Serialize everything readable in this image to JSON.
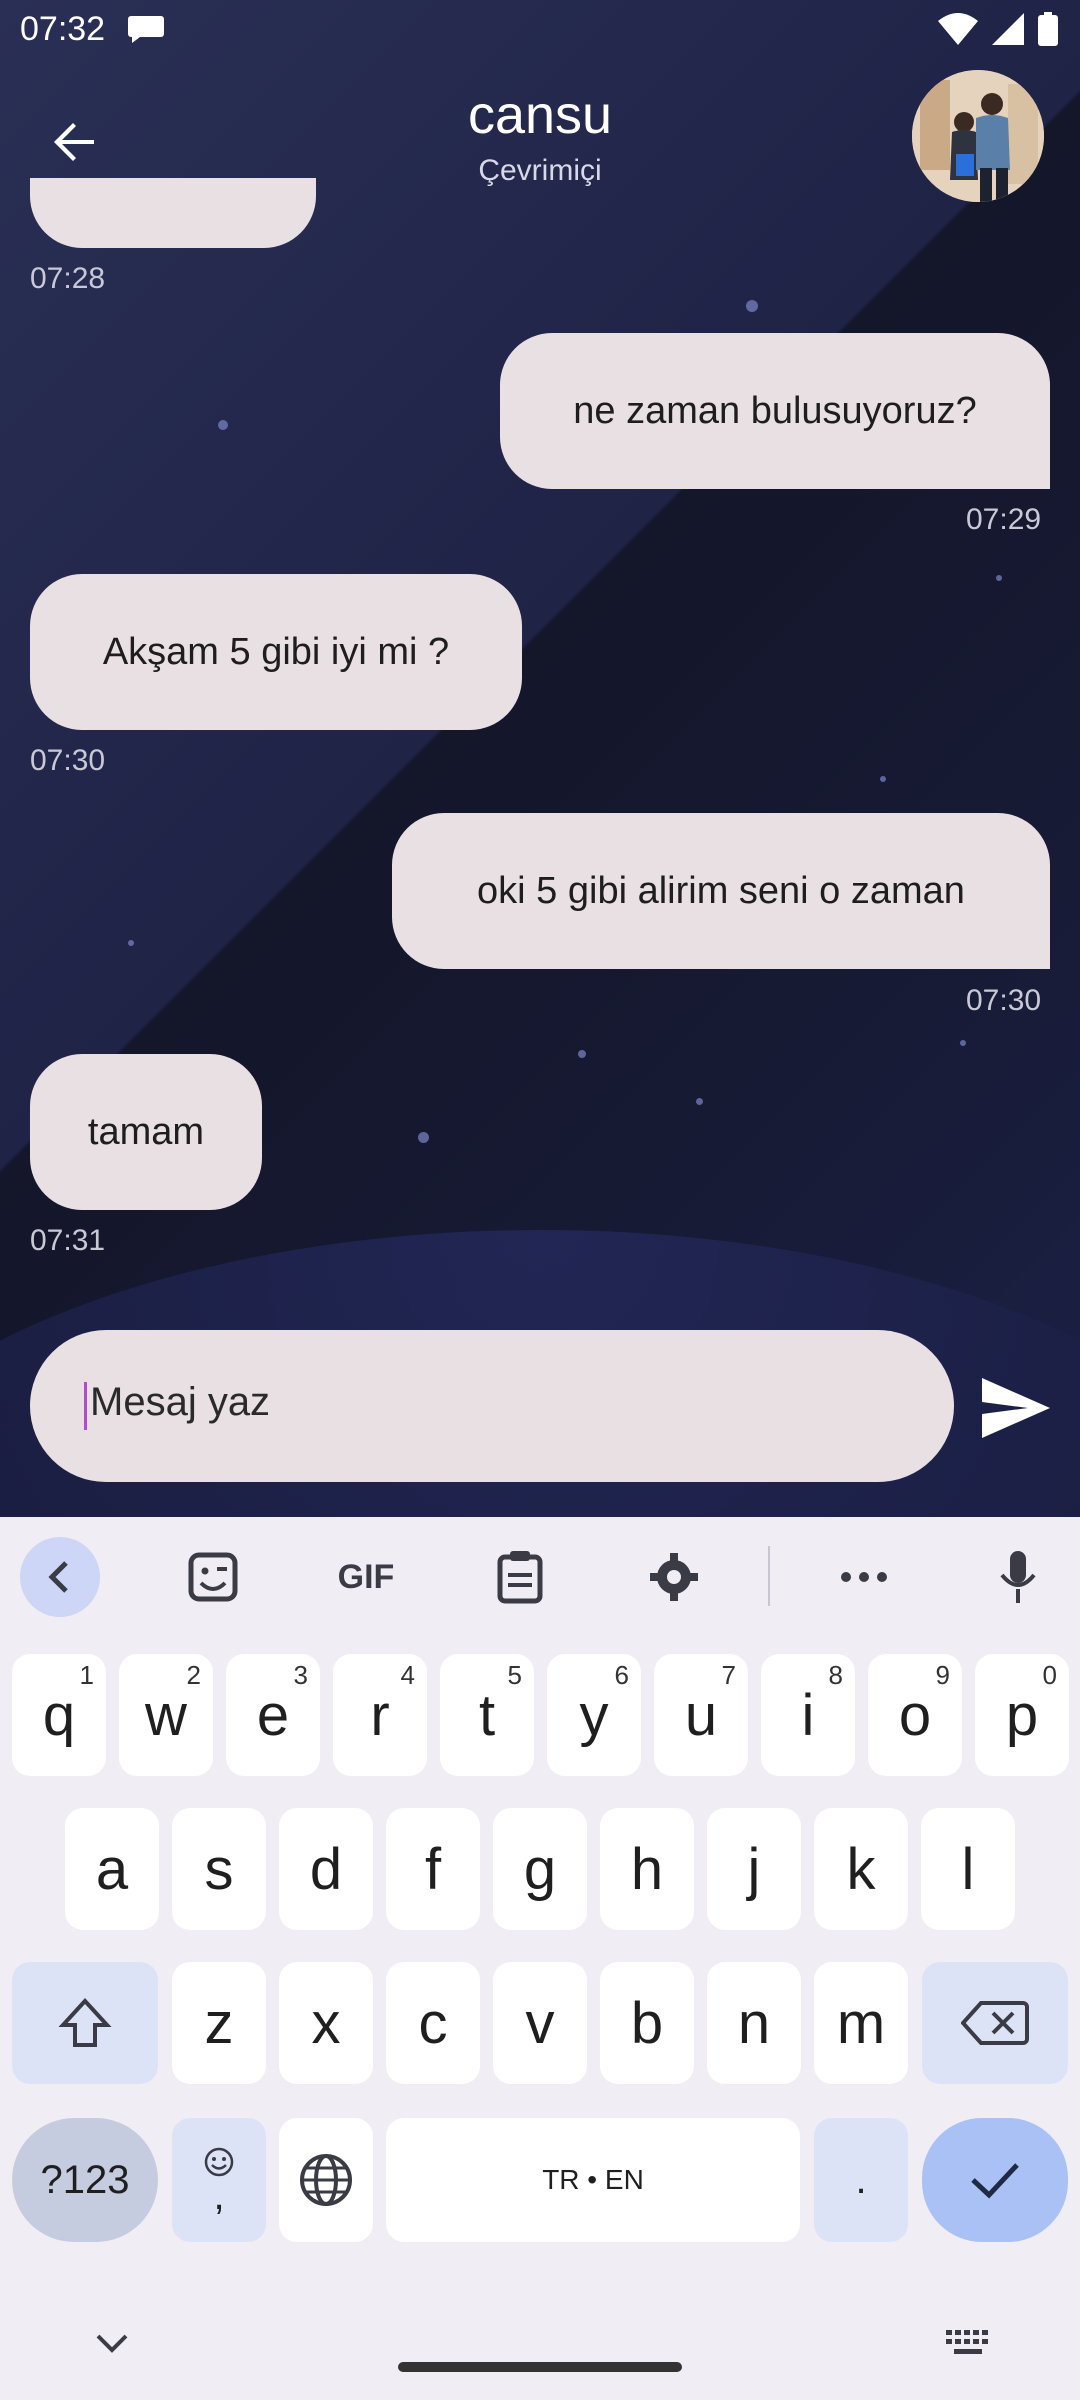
{
  "status_bar": {
    "time": "07:32"
  },
  "header": {
    "contact_name": "cansu",
    "contact_status": "Çevrimiçi"
  },
  "messages": [
    {
      "text": "",
      "time": "07:28",
      "side": "left"
    },
    {
      "text": "ne zaman bulusuyoruz?",
      "time": "07:29",
      "side": "right"
    },
    {
      "text": "Akşam 5 gibi iyi mi ?",
      "time": "07:30",
      "side": "left"
    },
    {
      "text": "oki 5 gibi alirim seni o zaman",
      "time": "07:30",
      "side": "right"
    },
    {
      "text": "tamam",
      "time": "07:31",
      "side": "left"
    }
  ],
  "composer": {
    "placeholder": "Mesaj yaz"
  },
  "keyboard": {
    "toolbar": {
      "gif": "GIF"
    },
    "row1": [
      "q",
      "w",
      "e",
      "r",
      "t",
      "y",
      "u",
      "i",
      "o",
      "p"
    ],
    "row1_hints": [
      "1",
      "2",
      "3",
      "4",
      "5",
      "6",
      "7",
      "8",
      "9",
      "0"
    ],
    "row2": [
      "a",
      "s",
      "d",
      "f",
      "g",
      "h",
      "j",
      "k",
      "l"
    ],
    "row3": [
      "z",
      "x",
      "c",
      "v",
      "b",
      "n",
      "m"
    ],
    "symbols": "?123",
    "emoji_comma": ",",
    "space": "TR • EN",
    "period": "."
  },
  "colors": {
    "bubble": "#e8e0e2",
    "background": "#1c2044",
    "keyboard": "#f0edf4",
    "enter_key": "#a9c1f5"
  }
}
